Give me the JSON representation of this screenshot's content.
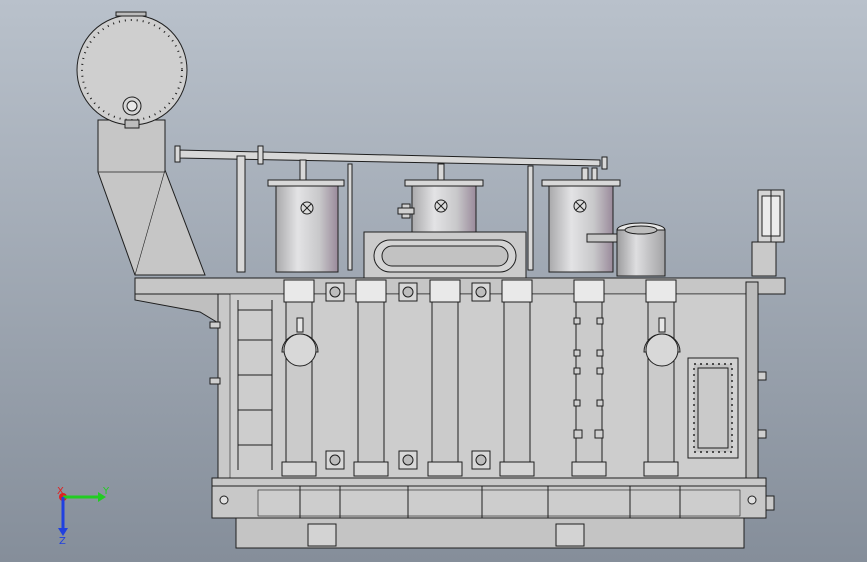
{
  "viewport": {
    "background_top": "#b9c1cb",
    "background_bottom": "#858e9a"
  },
  "model": {
    "body_color": "#c9c9c9",
    "body_dark": "#a9a9a9",
    "line_color": "#1f1f1f",
    "tank_color": "#d2d2d4",
    "accent_color": "#8f7f90"
  },
  "triad": {
    "x_label": "X",
    "y_label": "Y",
    "z_label": "Z",
    "x_color": "#e02020",
    "y_color": "#22cc22",
    "z_color": "#2040e0"
  }
}
